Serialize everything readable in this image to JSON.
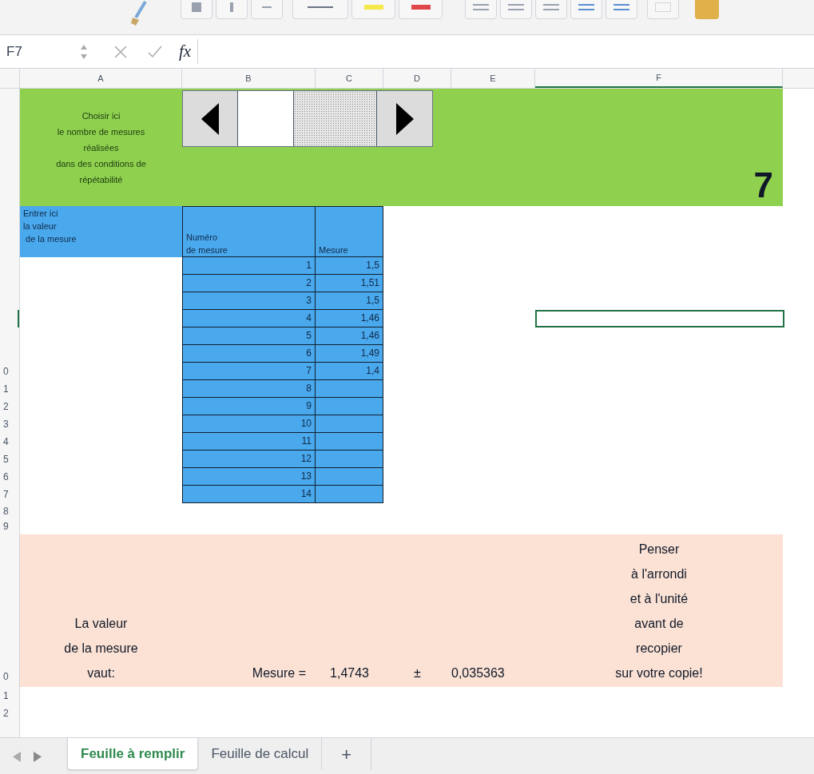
{
  "formula_bar": {
    "name_box": "F7",
    "fx": "fx"
  },
  "columns": [
    {
      "label": "A",
      "selected": false
    },
    {
      "label": "B",
      "selected": false
    },
    {
      "label": "C",
      "selected": false
    },
    {
      "label": "D",
      "selected": false
    },
    {
      "label": "E",
      "selected": false
    },
    {
      "label": "F",
      "selected": true
    }
  ],
  "control_panel": {
    "instructions": "Choisir ici\nle nombre de mesures\nréalisées\ndans des conditions de\nrépétabilité",
    "count": "7"
  },
  "table": {
    "entry_label": "Entrer ici\nla valeur\n de la mesure",
    "headers": [
      "Numéro\nde mesure",
      "Mesure"
    ],
    "rows": [
      {
        "number": "1",
        "value": "1,5",
        "selected": false
      },
      {
        "number": "2",
        "value": "1,51",
        "selected": false
      },
      {
        "number": "3",
        "value": "1,5",
        "selected": false
      },
      {
        "number": "4",
        "value": "1,46",
        "selected": true
      },
      {
        "number": "5",
        "value": "1,46",
        "selected": false
      },
      {
        "number": "6",
        "value": "1,49",
        "selected": false
      },
      {
        "number": "7",
        "value": "1,4",
        "row_label": "0",
        "selected": false
      },
      {
        "number": "8",
        "row_label": "1",
        "selected": false
      },
      {
        "number": "9",
        "row_label": "2",
        "selected": false
      },
      {
        "number": "10",
        "row_label": "3",
        "selected": false
      },
      {
        "number": "11",
        "row_label": "4",
        "selected": false
      },
      {
        "number": "12",
        "row_label": "5",
        "selected": false
      },
      {
        "number": "13",
        "row_label": "6",
        "selected": false
      },
      {
        "number": "14",
        "row_label": "7",
        "selected": false
      }
    ]
  },
  "gap_row_labels": [
    "8",
    "9"
  ],
  "result": {
    "row_label": "0",
    "label": "La valeur\nde la mesure\nvaut:",
    "prefix": "Mesure =",
    "value": "1,4743",
    "sign": "±",
    "uncertainty": "0,035363",
    "reminder": "Penser\nà l'arrondi\net à l'unité\navant de\nrecopier\nsur votre copie!"
  },
  "trailing_row_labels": [
    "1",
    "2"
  ],
  "sheet_tabs": [
    {
      "label": "Feuille à remplir",
      "selected": true
    },
    {
      "label": "Feuille de calcul",
      "selected": false
    }
  ],
  "add_sheet": "+"
}
